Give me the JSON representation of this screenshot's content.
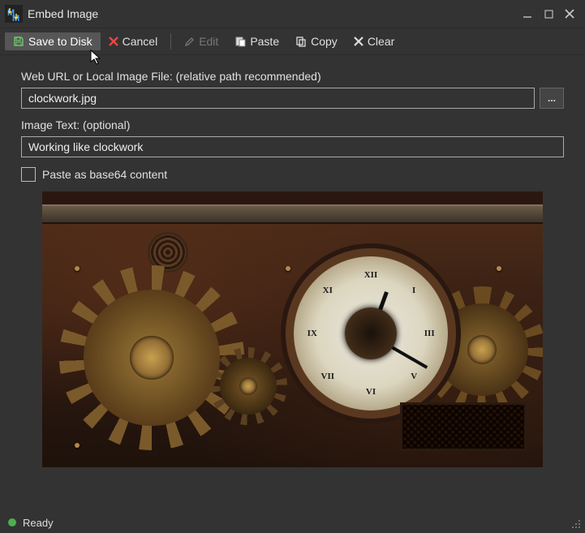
{
  "window": {
    "title": "Embed Image"
  },
  "toolbar": {
    "save_label": "Save to Disk",
    "cancel_label": "Cancel",
    "edit_label": "Edit",
    "paste_label": "Paste",
    "copy_label": "Copy",
    "clear_label": "Clear"
  },
  "form": {
    "url_label": "Web URL or Local Image File: (relative path recommended)",
    "url_value": "clockwork.jpg",
    "browse_label": "...",
    "text_label": "Image Text: (optional)",
    "text_value": "Working like clockwork",
    "base64_label": "Paste as base64 content"
  },
  "status": {
    "text": "Ready"
  }
}
